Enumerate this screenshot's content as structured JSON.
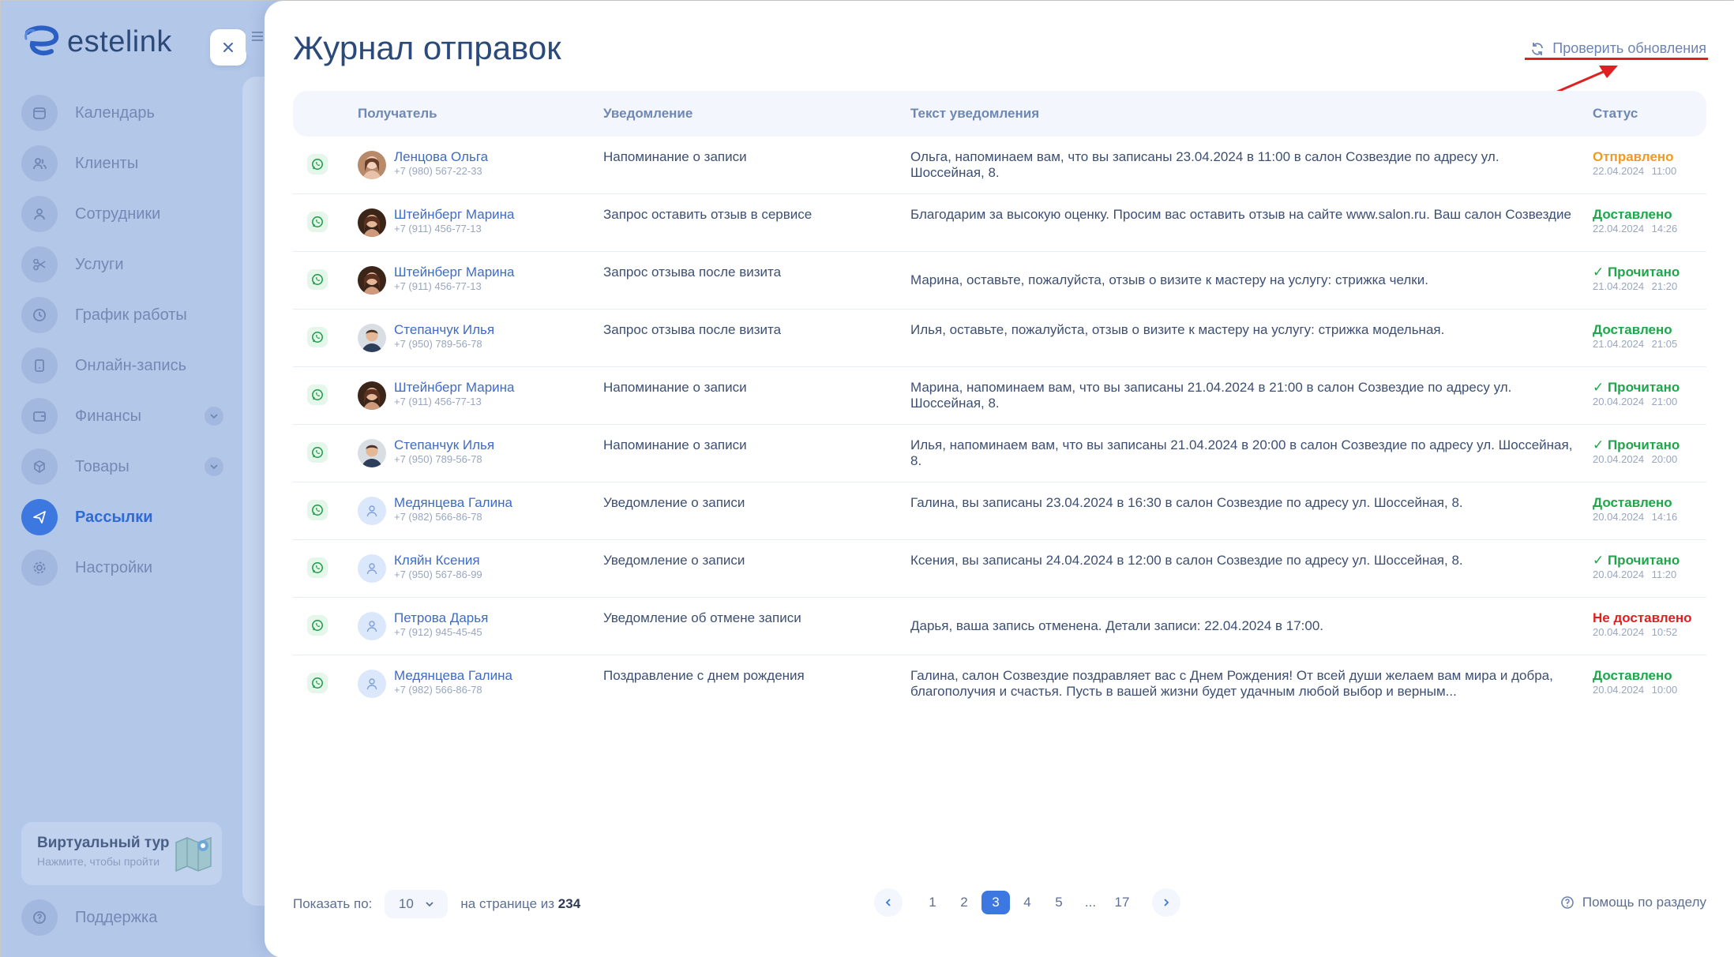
{
  "app": {
    "logo_text": "estelink"
  },
  "sidebar": {
    "items": [
      {
        "label": "Календарь",
        "icon": "calendar-icon"
      },
      {
        "label": "Клиенты",
        "icon": "clients-icon"
      },
      {
        "label": "Сотрудники",
        "icon": "user-icon"
      },
      {
        "label": "Услуги",
        "icon": "scissors-icon"
      },
      {
        "label": "График работы",
        "icon": "clock-icon"
      },
      {
        "label": "Онлайн-запись",
        "icon": "phone-icon"
      },
      {
        "label": "Финансы",
        "icon": "wallet-icon"
      },
      {
        "label": "Товары",
        "icon": "box-icon"
      },
      {
        "label": "Рассылки",
        "icon": "send-icon"
      },
      {
        "label": "Настройки",
        "icon": "gear-icon"
      }
    ],
    "tour": {
      "title": "Виртуальный тур",
      "subtitle": "Нажмите, чтобы пройти"
    },
    "support": "Поддержка"
  },
  "header": {
    "title": "Журнал отправок",
    "check_updates": "Проверить обновления"
  },
  "table": {
    "columns": [
      "Получатель",
      "Уведомление",
      "Текст уведомления",
      "Статус"
    ],
    "rows": [
      {
        "name": "Ленцова Ольга",
        "phone": "+7 (980) 567-22-33",
        "notification": "Напоминание о записи",
        "text": "Ольга, напоминаем вам, что вы записаны 23.04.2024 в 11:00 в салон Созвездие по адресу ул. Шоссейная, 8.",
        "status": "Отправлено",
        "date": "22.04.2024 11:00"
      },
      {
        "name": "Штейнберг Марина",
        "phone": "+7 (911) 456-77-13",
        "notification": "Запрос оставить отзыв в сервисе",
        "text": "Благодарим за высокую оценку. Просим вас оставить отзыв на сайте www.salon.ru. Ваш салон Созвездие",
        "status": "Доставлено",
        "date": "22.04.2024 14:26"
      },
      {
        "name": "Штейнберг Марина",
        "phone": "+7 (911) 456-77-13",
        "notification": "Запрос отзыва после визита",
        "text": "Марина, оставьте, пожалуйста, отзыв о визите к мастеру на услугу: стрижка челки.",
        "status": "✓ Прочитано",
        "date": "21.04.2024 21:20"
      },
      {
        "name": "Степанчук Илья",
        "phone": "+7 (950) 789-56-78",
        "notification": "Запрос отзыва после визита",
        "text": "Илья, оставьте, пожалуйста, отзыв о визите к мастеру на услугу: стрижка модельная.",
        "status": "Доставлено",
        "date": "21.04.2024 21:05"
      },
      {
        "name": "Штейнберг Марина",
        "phone": "+7 (911) 456-77-13",
        "notification": "Напоминание о записи",
        "text": "Марина, напоминаем вам, что вы записаны 21.04.2024 в 21:00 в салон Созвездие по адресу ул. Шоссейная, 8.",
        "status": "✓ Прочитано",
        "date": "20.04.2024 21:00"
      },
      {
        "name": "Степанчук Илья",
        "phone": "+7 (950) 789-56-78",
        "notification": "Напоминание о записи",
        "text": "Илья, напоминаем вам, что вы записаны 21.04.2024 в 20:00 в салон Созвездие по адресу ул. Шоссейная, 8.",
        "status": "✓ Прочитано",
        "date": "20.04.2024 20:00"
      },
      {
        "name": "Медянцева Галина",
        "phone": "+7 (982) 566-86-78",
        "notification": "Уведомление о записи",
        "text": "Галина, вы записаны 23.04.2024 в 16:30 в салон Созвездие по адресу ул. Шоссейная, 8.",
        "status": "Доставлено",
        "date": "20.04.2024 14:16"
      },
      {
        "name": "Кляйн Ксения",
        "phone": "+7 (950) 567-86-99",
        "notification": "Уведомление о записи",
        "text": "Ксения, вы записаны 24.04.2024 в 12:00 в салон Созвездие по адресу ул. Шоссейная, 8.",
        "status": "✓ Прочитано",
        "date": "20.04.2024 11:20"
      },
      {
        "name": "Петрова Дарья",
        "phone": "+7 (912) 945-45-45",
        "notification": "Уведомление об отмене записи",
        "text": "Дарья, ваша запись отменена. Детали записи: 22.04.2024 в 17:00.",
        "status": "Не доставлено",
        "date": "20.04.2024 10:52"
      },
      {
        "name": "Медянцева Галина",
        "phone": "+7 (982) 566-86-78",
        "notification": "Поздравление с днем рождения",
        "text": "Галина, салон Созвездие поздравляет вас с Днем Рождения! От всей души желаем вам мира и добра, благополучия и счастья. Пусть в вашей жизни будет удачным любой выбор и верным...",
        "status": "Доставлено",
        "date": "20.04.2024 10:00"
      }
    ]
  },
  "footer": {
    "show_label": "Показать по:",
    "per_page": "10",
    "of_label": "на странице из",
    "total": "234",
    "pages": [
      "1",
      "2",
      "3",
      "4",
      "5",
      "...",
      "17"
    ],
    "current_page": "3",
    "help": "Помощь по разделу"
  },
  "colors": {
    "accent": "#3d77e0",
    "sent": "#f09a1f",
    "delivered": "#1fa64a",
    "read": "#1fa64a",
    "failed": "#e0201f",
    "annotation": "#e0201f"
  }
}
